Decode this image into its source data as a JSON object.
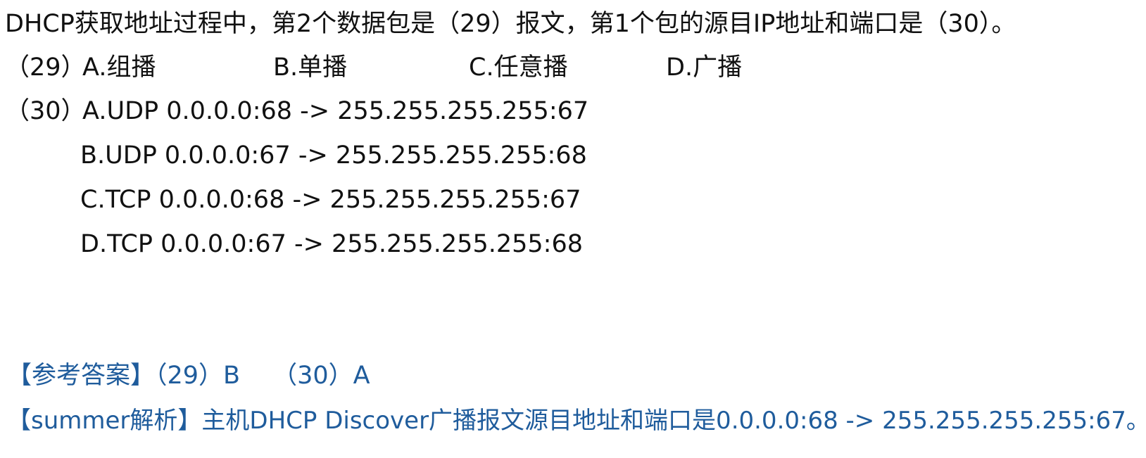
{
  "question": {
    "text": "DHCP获取地址过程中，第2个数据包是（29）报文，第1个包的源目IP地址和端口是（30）。"
  },
  "q29": {
    "number": "（29）",
    "options": [
      "A.组播",
      "B.单播",
      "C.任意播",
      "D.广播"
    ]
  },
  "q30": {
    "number": "（30）",
    "options": [
      "A.UDP 0.0.0.0:68 -> 255.255.255.255:67",
      "B.UDP 0.0.0.0:67 -> 255.255.255.255:68",
      "C.TCP 0.0.0.0:68 -> 255.255.255.255:67",
      "D.TCP 0.0.0.0:67 -> 255.255.255.255:68"
    ]
  },
  "answer": {
    "label": "【参考答案】",
    "part29": "（29）B",
    "part30": "（30）A"
  },
  "explanation": {
    "label": "【summer解析】",
    "text": "主机DHCP Discover广播报文源目地址和端口是0.0.0.0:68 -> 255.255.255.255:67。"
  },
  "colors": {
    "text": "#111111",
    "answer_blue": "#1f5c9c"
  }
}
